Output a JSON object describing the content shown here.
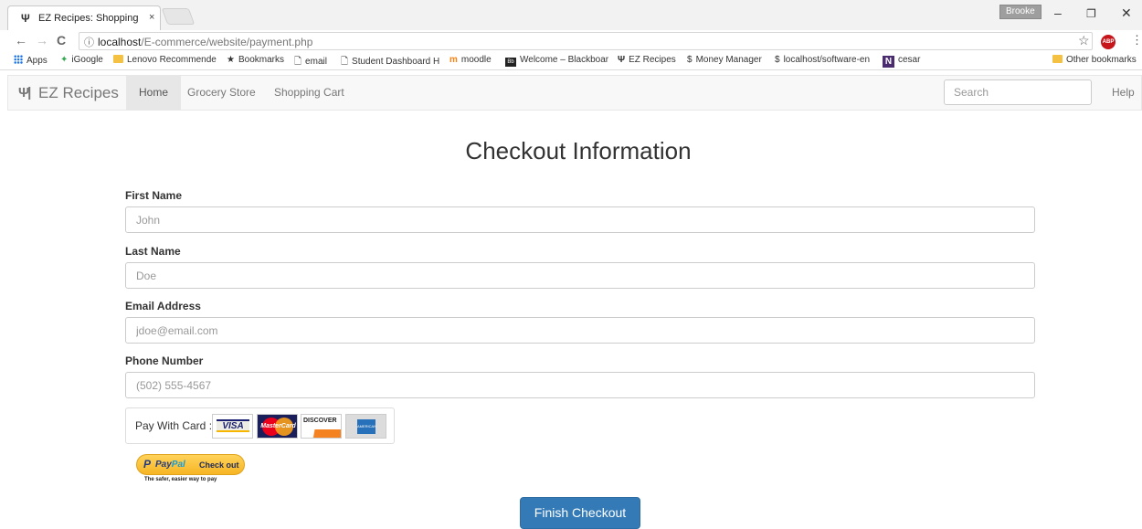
{
  "browser": {
    "tab_title": "EZ Recipes: Shopping Ca",
    "tab_close": "×",
    "profile_name": "Brooke",
    "window_controls": {
      "minimize": "–",
      "restore": "❐",
      "close": "✕"
    },
    "nav": {
      "back": "←",
      "forward": "→",
      "reload": "C"
    },
    "url_host": "localhost",
    "url_path": "/E-commerce/website/payment.php",
    "star": "☆",
    "abp_label": "ABP",
    "menu": "⋮"
  },
  "bookmarks": {
    "apps": "Apps",
    "igoogle": "iGoogle",
    "lenovo": "Lenovo Recommende",
    "bookmarks": "Bookmarks",
    "email": "email",
    "student": "Student Dashboard H",
    "moodle": "moodle",
    "blackboard": "Welcome – Blackboar",
    "ezrecipes": "EZ Recipes",
    "money": "Money Manager",
    "localhost": "localhost/software-en",
    "cesar": "cesar",
    "other": "Other bookmarks"
  },
  "navbar": {
    "brand_icon": "utensils-icon",
    "brand": "EZ Recipes",
    "items": [
      {
        "label": "Home",
        "active": true
      },
      {
        "label": "Grocery Store",
        "active": false
      },
      {
        "label": "Shopping Cart",
        "active": false
      }
    ],
    "search_placeholder": "Search",
    "help": "Help"
  },
  "form": {
    "title": "Checkout Information",
    "fields": [
      {
        "label": "First Name",
        "placeholder": "John"
      },
      {
        "label": "Last Name",
        "placeholder": "Doe"
      },
      {
        "label": "Email Address",
        "placeholder": "jdoe@email.com"
      },
      {
        "label": "Phone Number",
        "placeholder": "(502) 555-4567"
      }
    ],
    "pay_with_card": "Pay With Card :",
    "cards": {
      "visa": "VISA",
      "mastercard": "MasterCard",
      "discover": "DISCOVER",
      "amex": "AMERICAN EXPRESS"
    },
    "paypal": {
      "p": "P",
      "brand_a": "Pay",
      "brand_b": "Pal",
      "check": "Check out",
      "tagline": "The safer, easier way to pay"
    },
    "submit": "Finish Checkout"
  },
  "colors": {
    "primary": "#337ab7",
    "navbar_bg": "#f8f8f8",
    "paypal_yellow": "#ffc439"
  }
}
